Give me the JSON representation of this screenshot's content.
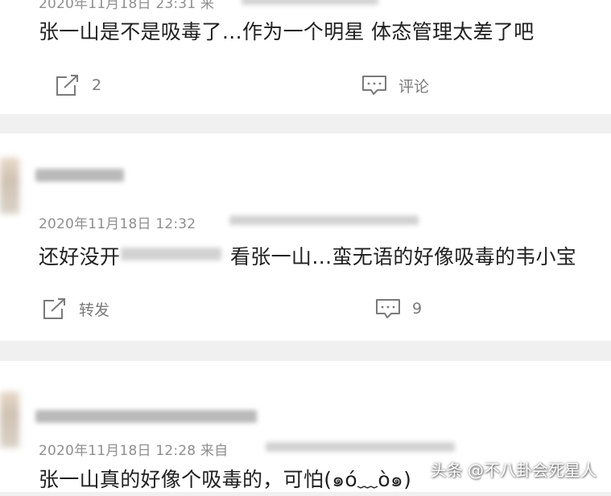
{
  "comments": [
    {
      "timestamp": "2020年11月18日 23:31 来",
      "text": "张一山是不是吸毒了…作为一个明星 体态管理太差了吧",
      "repost_label": "2",
      "comment_label": "评论"
    },
    {
      "timestamp": "2020年11月18日 12:32",
      "text_before": "还好没开",
      "text_after": "看张一山…蛮无语的好像吸毒的韦小宝",
      "repost_label": "转发",
      "comment_label": "9"
    },
    {
      "timestamp": "2020年11月18日 12:28 来自",
      "text": "张一山真的好像个吸毒的，可怕(๑ó﹏ò๑)"
    }
  ],
  "watermark": "头条 @不八卦会死星人",
  "icons": {
    "share": "share-icon",
    "comment": "comment-icon"
  },
  "colors": {
    "background": "#f0f0f0",
    "card": "#ffffff",
    "text": "#1f1f1f",
    "meta": "#8f8f8f",
    "icon": "#7a7a7a"
  }
}
